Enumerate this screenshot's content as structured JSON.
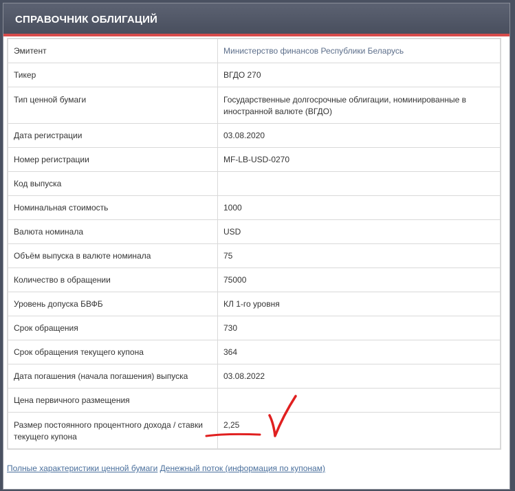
{
  "header": {
    "title": "СПРАВОЧНИК ОБЛИГАЦИЙ"
  },
  "rows": [
    {
      "label": "Эмитент",
      "value": "Министерство финансов Республики Беларусь"
    },
    {
      "label": "Тикер",
      "value": "ВГДО 270"
    },
    {
      "label": "Тип ценной бумаги",
      "value": "Государственные долгосрочные облигации, номинированные в иностранной валюте (ВГДО)"
    },
    {
      "label": "Дата регистрации",
      "value": "03.08.2020"
    },
    {
      "label": "Номер регистрации",
      "value": "MF-LB-USD-0270"
    },
    {
      "label": "Код выпуска",
      "value": ""
    },
    {
      "label": "Номинальная стоимость",
      "value": "1000"
    },
    {
      "label": "Валюта номинала",
      "value": "USD"
    },
    {
      "label": "Объём выпуска в валюте номинала",
      "value": "75"
    },
    {
      "label": "Количество в обращении",
      "value": "75000"
    },
    {
      "label": "Уровень допуска БВФБ",
      "value": "КЛ 1-го уровня"
    },
    {
      "label": "Срок обращения",
      "value": "730"
    },
    {
      "label": "Срок обращения текущего купона",
      "value": "364"
    },
    {
      "label": "Дата погашения (начала погашения) выпуска",
      "value": "03.08.2022"
    },
    {
      "label": "Цена первичного размещения",
      "value": ""
    },
    {
      "label": "Размер постоянного процентного дохода / ставки текущего купона",
      "value": "2,25"
    }
  ],
  "footer": {
    "link_full": "Полные характеристики ценной бумаги",
    "link_cashflow": "Денежный поток (информация по купонам)"
  },
  "colors": {
    "header_bg": "#4f5566",
    "accent": "#d64b4b",
    "annotation": "#e02020",
    "link": "#4a6f9c"
  }
}
